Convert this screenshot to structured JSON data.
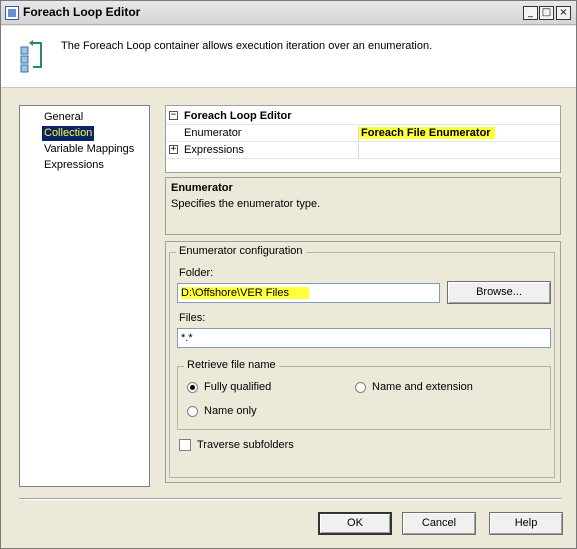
{
  "window": {
    "title": "Foreach Loop Editor",
    "controls": {
      "minimize": "_",
      "maximize": "□",
      "close": "×"
    }
  },
  "header": {
    "icon": "foreach-loop-icon",
    "description": "The Foreach Loop container allows execution iteration over an enumeration."
  },
  "nav": {
    "items": [
      {
        "label": "General",
        "selected": false
      },
      {
        "label": "Collection",
        "selected": true
      },
      {
        "label": "Variable Mappings",
        "selected": false
      },
      {
        "label": "Expressions",
        "selected": false
      }
    ]
  },
  "properties": {
    "category": "Foreach Loop Editor",
    "rows": [
      {
        "key": "Enumerator",
        "value": "Foreach File Enumerator"
      },
      {
        "key": "Expressions",
        "value": ""
      }
    ]
  },
  "description": {
    "title": "Enumerator",
    "text": "Specifies the enumerator type."
  },
  "config": {
    "group_label": "Enumerator configuration",
    "folder_label": "Folder:",
    "folder_value": "D:\\Offshore\\VER Files",
    "browse_label": "Browse...",
    "files_label": "Files:",
    "files_value": "*.*",
    "retrieve_label": "Retrieve file name",
    "options": [
      {
        "label": "Fully qualified",
        "checked": true
      },
      {
        "label": "Name and extension",
        "checked": false
      },
      {
        "label": "Name only",
        "checked": false
      }
    ],
    "traverse_label": "Traverse subfolders",
    "traverse_checked": false
  },
  "footer": {
    "ok_label": "OK",
    "cancel_label": "Cancel",
    "help_label": "Help"
  },
  "colors": {
    "highlight": "#ffff3a",
    "selection": "#0a246a"
  }
}
